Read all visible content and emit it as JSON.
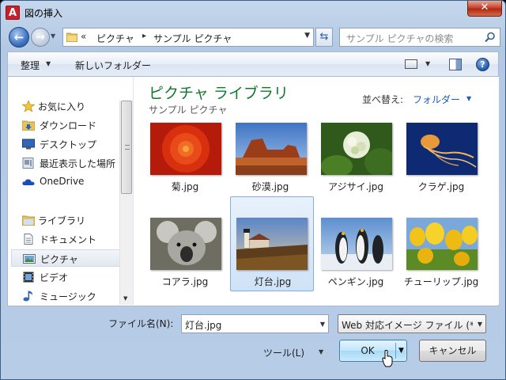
{
  "window": {
    "title": "図の挿入",
    "app_icon_letter": "A",
    "close_symbol": "✕"
  },
  "nav": {
    "breadcrumb_prefix": "«",
    "breadcrumb": [
      "ピクチャ",
      "サンプル ピクチャ"
    ],
    "search_placeholder": "サンプル ピクチャの検索"
  },
  "toolbar": {
    "organize": "整理",
    "new_folder": "新しいフォルダー"
  },
  "sidebar": {
    "items": [
      {
        "label": "お気に入り",
        "icon": "star-icon"
      },
      {
        "label": "ダウンロード",
        "icon": "download-folder-icon"
      },
      {
        "label": "デスクトップ",
        "icon": "desktop-icon"
      },
      {
        "label": "最近表示した場所",
        "icon": "recent-places-icon"
      },
      {
        "label": "OneDrive",
        "icon": "cloud-icon"
      },
      {
        "label": "ライブラリ",
        "icon": "library-folder-icon"
      },
      {
        "label": "ドキュメント",
        "icon": "document-icon"
      },
      {
        "label": "ピクチャ",
        "icon": "picture-icon",
        "selected": true
      },
      {
        "label": "ビデオ",
        "icon": "video-icon"
      },
      {
        "label": "ミュージック",
        "icon": "music-icon"
      }
    ]
  },
  "library": {
    "title": "ピクチャ ライブラリ",
    "subtitle": "サンプル ピクチャ",
    "arrange_label": "並べ替え:",
    "arrange_value": "フォルダー",
    "files": [
      {
        "name": "菊.jpg"
      },
      {
        "name": "砂漠.jpg"
      },
      {
        "name": "アジサイ.jpg"
      },
      {
        "name": "クラゲ.jpg"
      },
      {
        "name": "コアラ.jpg"
      },
      {
        "name": "灯台.jpg",
        "selected": true
      },
      {
        "name": "ペンギン.jpg"
      },
      {
        "name": "チューリップ.jpg"
      }
    ]
  },
  "footer": {
    "filename_label": "ファイル名(N):",
    "filename_value": "灯台.jpg",
    "filter_value": "Web 対応イメージ ファイル (*",
    "tools_label": "ツール(L)",
    "ok_label": "OK",
    "cancel_label": "キャンセル"
  }
}
